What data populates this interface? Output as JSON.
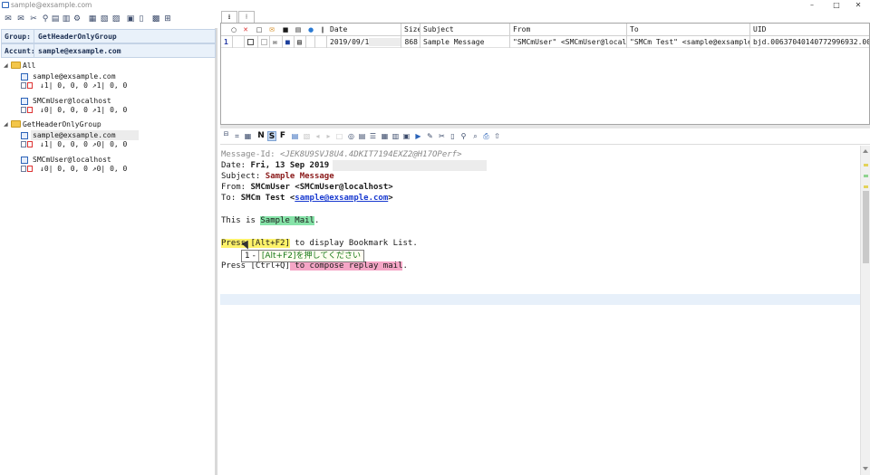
{
  "window": {
    "title": "sample@exsample.com",
    "controls": [
      "–",
      "□",
      "✕"
    ]
  },
  "left_panel": {
    "group_label": "Group:",
    "group_value": "GetHeaderOnlyGroup",
    "account_label": "Accunt:",
    "account_value": "sample@exsample.com",
    "tree": [
      {
        "type": "folder",
        "label": "All"
      },
      {
        "type": "account",
        "label": "sample@exsample.com",
        "stats": "↓1| 0, 0, 0 ↗1| 0, 0"
      },
      {
        "type": "account",
        "label": "SMCmUser@localhost",
        "stats": "↓0| 0, 0, 0 ↗1| 0, 0"
      },
      {
        "type": "folder",
        "label": "GetHeaderOnlyGroup"
      },
      {
        "type": "account",
        "label": "sample@exsample.com",
        "stats": "↓1| 0, 0, 0 ↗0| 0, 0",
        "selected": true
      },
      {
        "type": "account",
        "label": "SMCmUser@localhost",
        "stats": "↓0| 0, 0, 0 ↗0| 0, 0"
      }
    ]
  },
  "message_list": {
    "headers": {
      "date": "Date",
      "size": "Size",
      "subject": "Subject",
      "from": "From",
      "to": "To",
      "uid": "UID"
    },
    "rows": [
      {
        "index": "1",
        "date": "2019/09/13",
        "size": "868",
        "subject": "Sample Message",
        "from": "\"SMCmUser\" <SMCmUser@localhost>",
        "to": "\"SMCm Test\" <sample@exsample.com>",
        "uid": "bjd.00637040140772996932.000"
      }
    ]
  },
  "viewer_toolbar": {
    "letters": [
      "N",
      "S",
      "F"
    ]
  },
  "viewer": {
    "message_id_label": "Message-Id:",
    "message_id_value": "<JEK8U9SVJ8U4.4DKIT7194EXZ2@H17OPerf>",
    "date_label": "Date:",
    "date_value": "Fri, 13 Sep 2019",
    "subject_label": "Subject:",
    "subject_value": "Sample Message",
    "from_label": "From:",
    "from_value": "SMCmUser <SMCmUser@localhost>",
    "to_label": "To:",
    "to_name": "SMCm Test <",
    "to_link": "sample@exsample.com",
    "to_close": ">",
    "body_line1_pre": "This is ",
    "body_line1_hl": "Sample Mail",
    "body_line1_post": ".",
    "body_line2_hl": "Press [Alt+F2]",
    "body_line2_post": " to display Bookmark List.",
    "body_line3_pre": "Press [Ctrl+Q]",
    "body_line3_hl": " to compose replay mail",
    "body_line3_post": ".",
    "tooltip_num": "1 -",
    "tooltip_text": "[Alt+F2]を押してください"
  }
}
